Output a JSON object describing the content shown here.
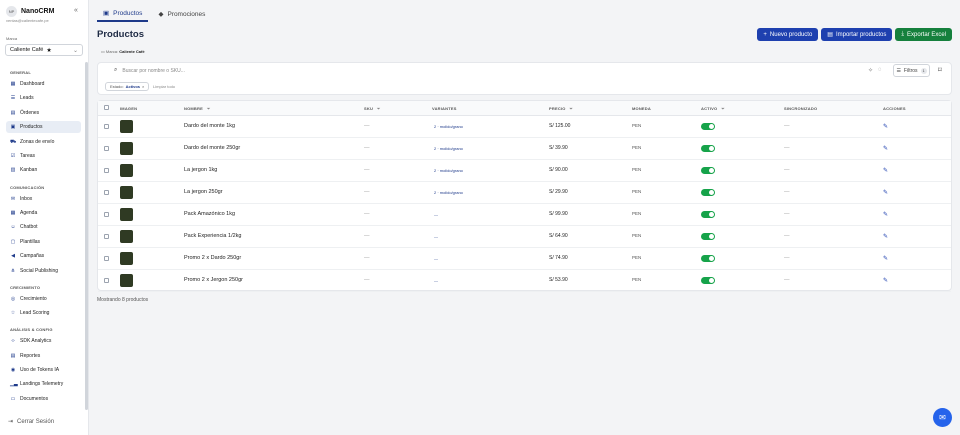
{
  "sidebar": {
    "logo_text": "NP",
    "brand": "NanoCRM",
    "email": "ventas@calientecafe.pe",
    "brand_label": "Marca",
    "brand_value": "Caliente Café",
    "groups": {
      "general": "GENERAL",
      "comunicacion": "COMUNICACIÓN",
      "crecimiento": "CRECIMIENTO",
      "analisis": "ANÁLISIS & CONFIG"
    },
    "items": [
      {
        "label": "Dashboard",
        "icon": "grid-icon"
      },
      {
        "label": "Leads",
        "icon": "list-icon"
      },
      {
        "label": "Órdenes",
        "icon": "orders-icon"
      },
      {
        "label": "Productos",
        "icon": "box-icon"
      },
      {
        "label": "Zonas de envío",
        "icon": "truck-icon"
      },
      {
        "label": "Tareas",
        "icon": "tasks-icon"
      },
      {
        "label": "Kanban",
        "icon": "kanban-icon"
      },
      {
        "label": "Inbox",
        "icon": "inbox-icon"
      },
      {
        "label": "Agenda",
        "icon": "calendar-icon"
      },
      {
        "label": "Chatbot",
        "icon": "bot-icon"
      },
      {
        "label": "Plantillas",
        "icon": "template-icon"
      },
      {
        "label": "Campañas",
        "icon": "megaphone-icon"
      },
      {
        "label": "Social Publishing",
        "icon": "share-icon"
      },
      {
        "label": "Crecimiento",
        "icon": "growth-icon"
      },
      {
        "label": "Lead Scoring",
        "icon": "star-icon"
      },
      {
        "label": "SDK Analytics",
        "icon": "code-icon"
      },
      {
        "label": "Reportes",
        "icon": "report-icon"
      },
      {
        "label": "Uso de Tokens IA",
        "icon": "token-icon"
      },
      {
        "label": "Landings Telemetry",
        "icon": "chart-icon"
      },
      {
        "label": "Documentos",
        "icon": "folder-icon"
      }
    ],
    "logout": "Cerrar Sesión"
  },
  "tabs": [
    {
      "label": "Productos"
    },
    {
      "label": "Promociones"
    }
  ],
  "page_title": "Productos",
  "breadcrumb": {
    "label": "Marca:",
    "value": "Caliente Café"
  },
  "actions": {
    "new": "Nuevo producto",
    "import": "Importar productos",
    "export": "Exportar Excel"
  },
  "search": {
    "placeholder": "Buscar por nombre o SKU..."
  },
  "filters": {
    "label": "Filtros",
    "count": "1",
    "chip_label": "Estado:",
    "chip_value": "Activos",
    "clear": "Limpiar todo"
  },
  "columns": {
    "image": "IMAGEN",
    "name": "NOMBRE",
    "sku": "SKU",
    "variants": "VARIANTES",
    "price": "PRECIO",
    "currency": "MONEDA",
    "active": "ACTIVO",
    "sync": "SINCRONIZADO",
    "actions": "ACCIONES"
  },
  "rows": [
    {
      "name": "Dardo del monte 1kg",
      "sku": "—",
      "variants": "2 · molido/grano",
      "price": "S/ 125.00",
      "currency": "PEN",
      "sync": "—"
    },
    {
      "name": "Dardo del monte 250gr",
      "sku": "—",
      "variants": "2 · molido/grano",
      "price": "S/ 39.90",
      "currency": "PEN",
      "sync": "—"
    },
    {
      "name": "La jergon 1kg",
      "sku": "—",
      "variants": "2 · molido/grano",
      "price": "S/ 90.00",
      "currency": "PEN",
      "sync": "—"
    },
    {
      "name": "La jergon 250gr",
      "sku": "—",
      "variants": "2 · molido/grano",
      "price": "S/ 29.90",
      "currency": "PEN",
      "sync": "—"
    },
    {
      "name": "Pack Amazónico 1kg",
      "sku": "—",
      "variants": "—",
      "price": "S/ 99.90",
      "currency": "PEN",
      "sync": "—"
    },
    {
      "name": "Pack Experiencia 1/2kg",
      "sku": "—",
      "variants": "—",
      "price": "S/ 64.90",
      "currency": "PEN",
      "sync": "—"
    },
    {
      "name": "Promo 2 x Dardo 250gr",
      "sku": "—",
      "variants": "—",
      "price": "S/ 74.90",
      "currency": "PEN",
      "sync": "—"
    },
    {
      "name": "Promo 2 x Jergon 250gr",
      "sku": "—",
      "variants": "—",
      "price": "S/ 53.90",
      "currency": "PEN",
      "sync": "—"
    }
  ],
  "footer": "Mostrando 8 productos",
  "colors": {
    "accent": "#1e40af",
    "export": "#15803d",
    "toggle_on": "#16a34a"
  }
}
